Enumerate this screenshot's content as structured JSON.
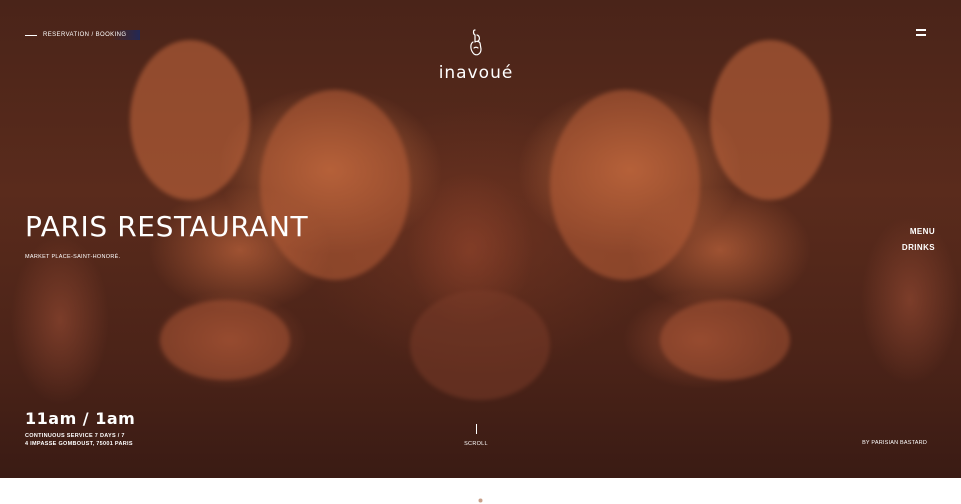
{
  "header": {
    "booking_link": "RESERVATION / BOOKING",
    "logo_text": "inavoué",
    "menu_icon": "hamburger-menu-icon"
  },
  "hero": {
    "title": "PARIS RESTAURANT",
    "subtitle": "MARKET PLACE-SAINT-HONORÉ.",
    "side_links": [
      "MENU",
      "DRINKS"
    ],
    "hours": "11am / 1am",
    "service": "CONTINUOUS SERVICE 7 DAYS / 7",
    "address": "4 IMPASSE GOMBOUST, 75001 PARIS",
    "scroll_label": "SCROLL",
    "credit": "BY PARISIAN BASTARD"
  },
  "colors": {
    "hero_dark": "#4a2419",
    "hero_glow": "#d2784a",
    "text": "#ffffff",
    "booking_accent": "#1e285a"
  }
}
